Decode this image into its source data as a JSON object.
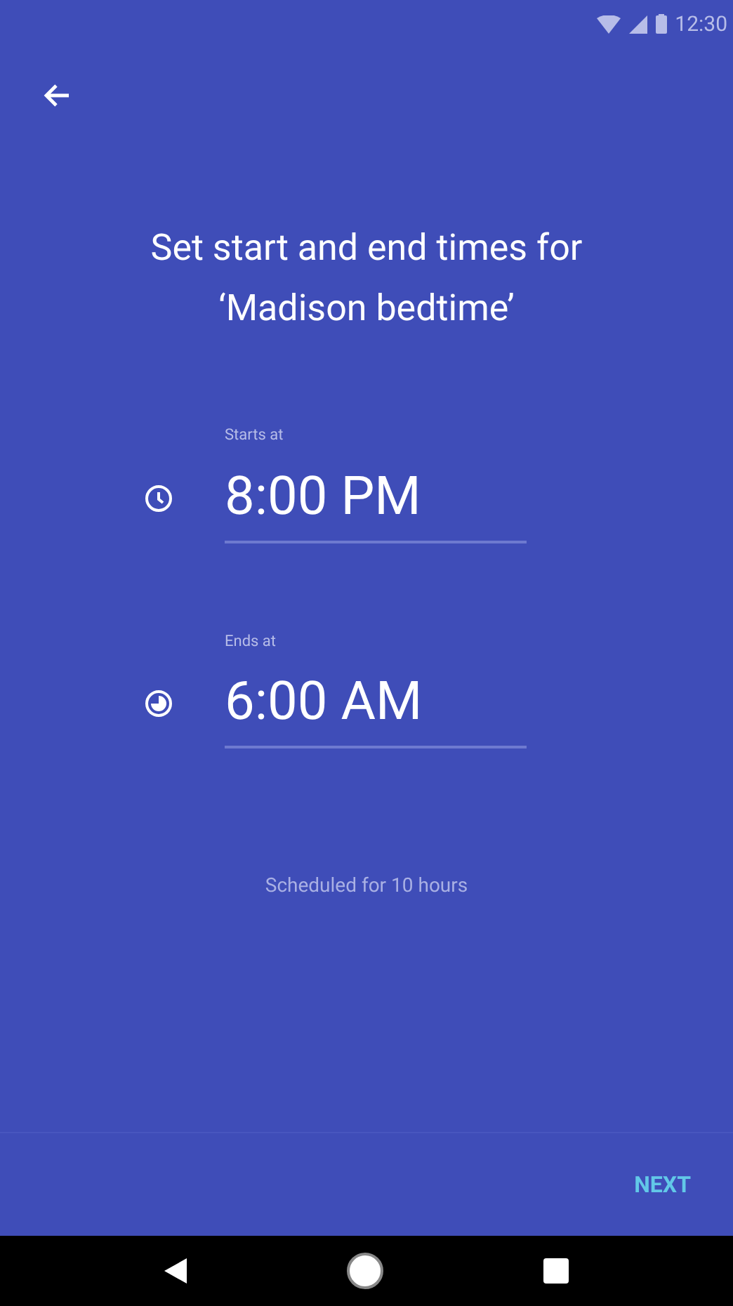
{
  "status_bar": {
    "time": "12:30"
  },
  "title": "Set start and end times for ‘Madison bedtime’",
  "times": [
    {
      "kind": "start",
      "label": "Starts at",
      "value": "8:00 PM"
    },
    {
      "kind": "end",
      "label": "Ends at",
      "value": "6:00 AM"
    }
  ],
  "summary": "Scheduled for 10 hours",
  "next_button": "NEXT"
}
